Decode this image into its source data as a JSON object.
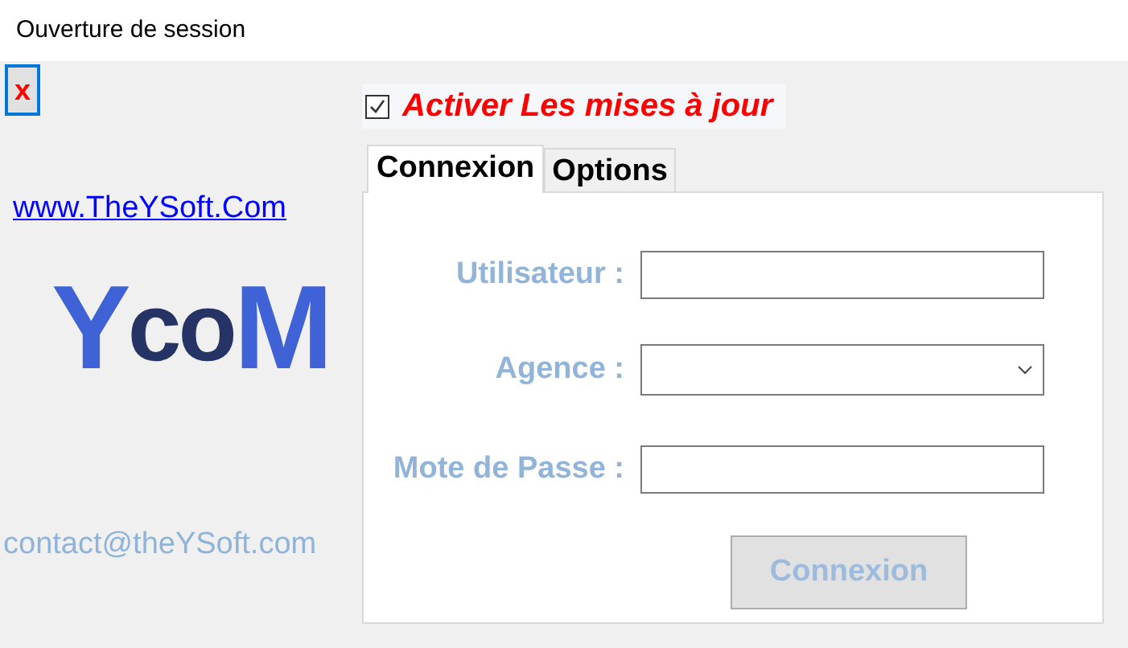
{
  "window": {
    "title": "Ouverture de session"
  },
  "close_button": {
    "label": "x"
  },
  "updates_checkbox": {
    "label": "Activer Les mises à jour",
    "checked": true
  },
  "website_link": "www.TheYSoft.Com",
  "logo": {
    "parts": [
      "Y",
      "co",
      "M"
    ]
  },
  "contact": "contact@theYSoft.com",
  "tabs": [
    {
      "label": "Connexion",
      "selected": true
    },
    {
      "label": "Options",
      "selected": false
    }
  ],
  "form": {
    "fields": [
      {
        "kind": "text",
        "label": "Utilisateur :"
      },
      {
        "kind": "dropdown",
        "label": "Agence :"
      },
      {
        "kind": "password",
        "label": "Mote de Passe :"
      }
    ],
    "submit": {
      "label": "Connexion",
      "disabled": true
    }
  }
}
